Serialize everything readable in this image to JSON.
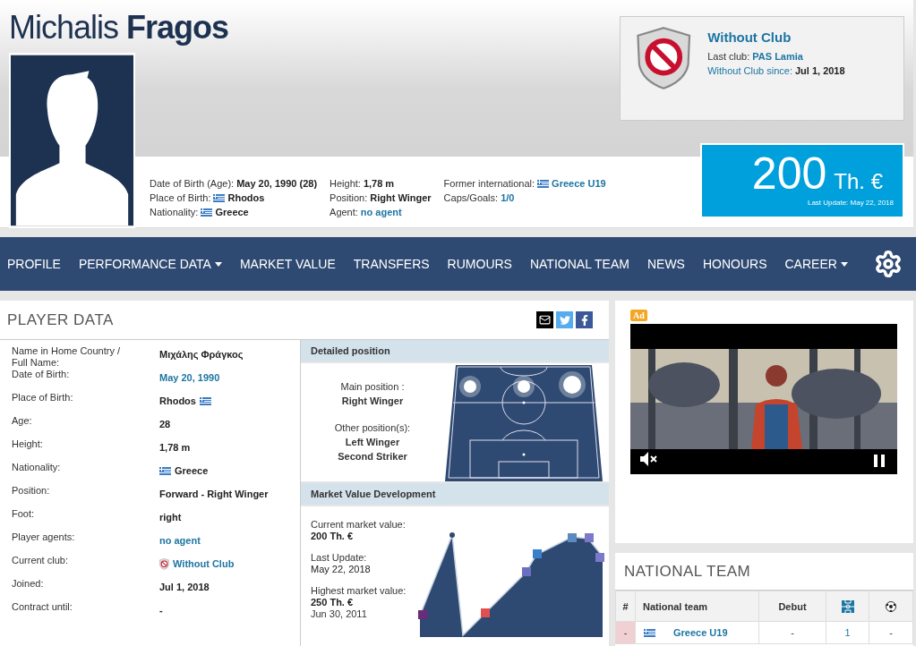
{
  "player": {
    "name": "Michalis **Fragos**"
  },
  "header_info": [
    [
      {
        "label": "Date of Birth (Age):",
        "value": "May 20, 1990 (28)",
        "kind": "text"
      },
      {
        "label": "Place of Birth:",
        "value": "Rhodos",
        "kind": "flag_text"
      },
      {
        "label": "Nationality:",
        "value": "Greece",
        "kind": "flag_text"
      }
    ],
    [
      {
        "label": "Height:",
        "value": "1,78 m",
        "kind": "text"
      },
      {
        "label": "Position:",
        "value": "Right Winger",
        "kind": "text"
      },
      {
        "label": "Agent:",
        "value": "no agent",
        "kind": "link"
      }
    ],
    [
      {
        "label": "Former international:",
        "value": "Greece U19",
        "kind": "flag_link"
      },
      {
        "label": "Caps/Goals:",
        "value": "1/0",
        "kind": "link"
      }
    ]
  ],
  "club_box": {
    "title": "Without Club",
    "last_club_label": "Last club:",
    "last_club": "PAS Lamia",
    "since_label": "Without Club since:",
    "since": "Jul 1, 2018"
  },
  "market_value": {
    "amount": "200",
    "unit": "Th. €",
    "last_update": "Last Update: May 22, 2018"
  },
  "nav": [
    {
      "label": "PROFILE",
      "dropdown": false
    },
    {
      "label": "PERFORMANCE DATA",
      "dropdown": true
    },
    {
      "label": "MARKET VALUE",
      "dropdown": false
    },
    {
      "label": "TRANSFERS",
      "dropdown": false
    },
    {
      "label": "RUMOURS",
      "dropdown": false
    },
    {
      "label": "NATIONAL TEAM",
      "dropdown": false
    },
    {
      "label": "NEWS",
      "dropdown": false
    },
    {
      "label": "HONOURS",
      "dropdown": false
    },
    {
      "label": "CAREER",
      "dropdown": true
    }
  ],
  "player_data": {
    "title": "PLAYER DATA",
    "rows": [
      {
        "label": "Name in Home Country / Full Name:",
        "value": "Μιχάλης Φράγκος",
        "kind": "text"
      },
      {
        "label": "Date of Birth:",
        "value": "May 20, 1990",
        "kind": "link"
      },
      {
        "label": "Place of Birth:",
        "value": "Rhodos",
        "kind": "text_flag"
      },
      {
        "label": "Age:",
        "value": "28",
        "kind": "text"
      },
      {
        "label": "Height:",
        "value": "1,78 m",
        "kind": "text"
      },
      {
        "label": "Nationality:",
        "value": "Greece",
        "kind": "flag_text"
      },
      {
        "label": "Position:",
        "value": "Forward - Right Winger",
        "kind": "text"
      },
      {
        "label": "Foot:",
        "value": "right",
        "kind": "text"
      },
      {
        "label": "Player agents:",
        "value": "no agent",
        "kind": "link"
      },
      {
        "label": "Current club:",
        "value": "Without Club",
        "kind": "club_link"
      },
      {
        "label": "Joined:",
        "value": "Jul 1, 2018",
        "kind": "text"
      },
      {
        "label": "Contract until:",
        "value": "-",
        "kind": "text"
      }
    ]
  },
  "detailed_position": {
    "title": "Detailed position",
    "main_label": "Main position :",
    "main": "Right Winger",
    "other_label": "Other position(s):",
    "others": [
      "Left Winger",
      "Second Striker"
    ]
  },
  "market_value_development": {
    "title": "Market Value Development",
    "items": [
      {
        "label": "Current market value:",
        "value": "200 Th. €",
        "kind": "bold"
      },
      {
        "label": "Last Update:",
        "value": "May 22, 2018",
        "kind": "plain"
      },
      {
        "label": "Highest market value:",
        "value": "250 Th. €",
        "kind": "bold",
        "date": "Jun 30, 2011"
      }
    ]
  },
  "ad": {
    "badge": "Ad"
  },
  "national_team": {
    "title": "NATIONAL TEAM",
    "columns": [
      {
        "label": "#",
        "kind": "text"
      },
      {
        "label": "National team",
        "kind": "text"
      },
      {
        "label": "Debut",
        "kind": "text"
      },
      {
        "kind": "pitch"
      },
      {
        "kind": "ball"
      }
    ],
    "rows": [
      {
        "number": "-",
        "team": "Greece U19",
        "debut": "-",
        "matches": "1",
        "goals": "-"
      }
    ]
  }
}
